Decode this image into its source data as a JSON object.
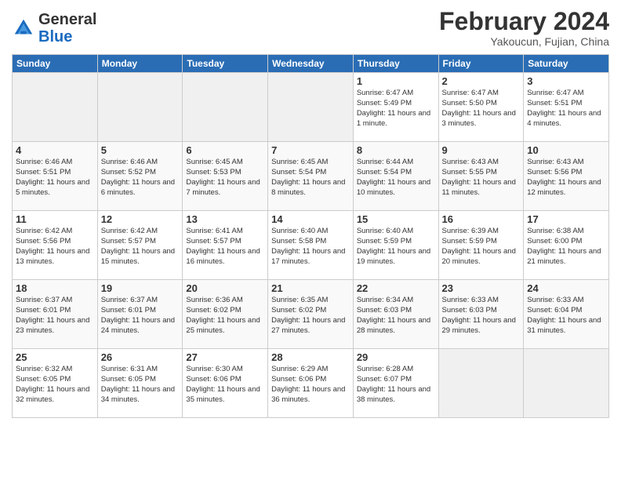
{
  "header": {
    "logo_line1": "General",
    "logo_line2": "Blue",
    "month_year": "February 2024",
    "location": "Yakoucun, Fujian, China"
  },
  "weekdays": [
    "Sunday",
    "Monday",
    "Tuesday",
    "Wednesday",
    "Thursday",
    "Friday",
    "Saturday"
  ],
  "weeks": [
    [
      {
        "day": "",
        "empty": true
      },
      {
        "day": "",
        "empty": true
      },
      {
        "day": "",
        "empty": true
      },
      {
        "day": "",
        "empty": true
      },
      {
        "day": "1",
        "sunrise": "6:47 AM",
        "sunset": "5:49 PM",
        "daylight": "11 hours and 1 minute."
      },
      {
        "day": "2",
        "sunrise": "6:47 AM",
        "sunset": "5:50 PM",
        "daylight": "11 hours and 3 minutes."
      },
      {
        "day": "3",
        "sunrise": "6:47 AM",
        "sunset": "5:51 PM",
        "daylight": "11 hours and 4 minutes."
      }
    ],
    [
      {
        "day": "4",
        "sunrise": "6:46 AM",
        "sunset": "5:51 PM",
        "daylight": "11 hours and 5 minutes."
      },
      {
        "day": "5",
        "sunrise": "6:46 AM",
        "sunset": "5:52 PM",
        "daylight": "11 hours and 6 minutes."
      },
      {
        "day": "6",
        "sunrise": "6:45 AM",
        "sunset": "5:53 PM",
        "daylight": "11 hours and 7 minutes."
      },
      {
        "day": "7",
        "sunrise": "6:45 AM",
        "sunset": "5:54 PM",
        "daylight": "11 hours and 8 minutes."
      },
      {
        "day": "8",
        "sunrise": "6:44 AM",
        "sunset": "5:54 PM",
        "daylight": "11 hours and 10 minutes."
      },
      {
        "day": "9",
        "sunrise": "6:43 AM",
        "sunset": "5:55 PM",
        "daylight": "11 hours and 11 minutes."
      },
      {
        "day": "10",
        "sunrise": "6:43 AM",
        "sunset": "5:56 PM",
        "daylight": "11 hours and 12 minutes."
      }
    ],
    [
      {
        "day": "11",
        "sunrise": "6:42 AM",
        "sunset": "5:56 PM",
        "daylight": "11 hours and 13 minutes."
      },
      {
        "day": "12",
        "sunrise": "6:42 AM",
        "sunset": "5:57 PM",
        "daylight": "11 hours and 15 minutes."
      },
      {
        "day": "13",
        "sunrise": "6:41 AM",
        "sunset": "5:57 PM",
        "daylight": "11 hours and 16 minutes."
      },
      {
        "day": "14",
        "sunrise": "6:40 AM",
        "sunset": "5:58 PM",
        "daylight": "11 hours and 17 minutes."
      },
      {
        "day": "15",
        "sunrise": "6:40 AM",
        "sunset": "5:59 PM",
        "daylight": "11 hours and 19 minutes."
      },
      {
        "day": "16",
        "sunrise": "6:39 AM",
        "sunset": "5:59 PM",
        "daylight": "11 hours and 20 minutes."
      },
      {
        "day": "17",
        "sunrise": "6:38 AM",
        "sunset": "6:00 PM",
        "daylight": "11 hours and 21 minutes."
      }
    ],
    [
      {
        "day": "18",
        "sunrise": "6:37 AM",
        "sunset": "6:01 PM",
        "daylight": "11 hours and 23 minutes."
      },
      {
        "day": "19",
        "sunrise": "6:37 AM",
        "sunset": "6:01 PM",
        "daylight": "11 hours and 24 minutes."
      },
      {
        "day": "20",
        "sunrise": "6:36 AM",
        "sunset": "6:02 PM",
        "daylight": "11 hours and 25 minutes."
      },
      {
        "day": "21",
        "sunrise": "6:35 AM",
        "sunset": "6:02 PM",
        "daylight": "11 hours and 27 minutes."
      },
      {
        "day": "22",
        "sunrise": "6:34 AM",
        "sunset": "6:03 PM",
        "daylight": "11 hours and 28 minutes."
      },
      {
        "day": "23",
        "sunrise": "6:33 AM",
        "sunset": "6:03 PM",
        "daylight": "11 hours and 29 minutes."
      },
      {
        "day": "24",
        "sunrise": "6:33 AM",
        "sunset": "6:04 PM",
        "daylight": "11 hours and 31 minutes."
      }
    ],
    [
      {
        "day": "25",
        "sunrise": "6:32 AM",
        "sunset": "6:05 PM",
        "daylight": "11 hours and 32 minutes."
      },
      {
        "day": "26",
        "sunrise": "6:31 AM",
        "sunset": "6:05 PM",
        "daylight": "11 hours and 34 minutes."
      },
      {
        "day": "27",
        "sunrise": "6:30 AM",
        "sunset": "6:06 PM",
        "daylight": "11 hours and 35 minutes."
      },
      {
        "day": "28",
        "sunrise": "6:29 AM",
        "sunset": "6:06 PM",
        "daylight": "11 hours and 36 minutes."
      },
      {
        "day": "29",
        "sunrise": "6:28 AM",
        "sunset": "6:07 PM",
        "daylight": "11 hours and 38 minutes."
      },
      {
        "day": "",
        "empty": true
      },
      {
        "day": "",
        "empty": true
      }
    ]
  ],
  "labels": {
    "sunrise": "Sunrise:",
    "sunset": "Sunset:",
    "daylight": "Daylight:"
  }
}
